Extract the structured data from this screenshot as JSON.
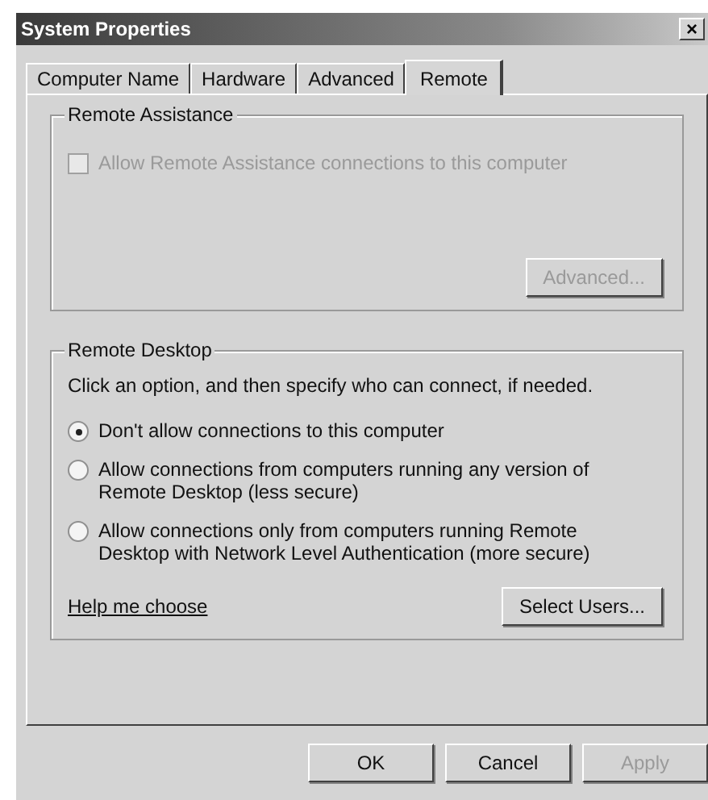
{
  "window": {
    "title": "System Properties",
    "close": "×"
  },
  "tabs": [
    {
      "label": "Computer Name",
      "selected": false
    },
    {
      "label": "Hardware",
      "selected": false
    },
    {
      "label": "Advanced",
      "selected": false
    },
    {
      "label": "Remote",
      "selected": true
    }
  ],
  "remote_assistance": {
    "title": "Remote Assistance",
    "checkbox": {
      "label": "Allow Remote Assistance connections to this computer",
      "checked": false,
      "disabled": true
    },
    "button": {
      "label": "Advanced...",
      "disabled": true
    }
  },
  "remote_desktop": {
    "title": "Remote Desktop",
    "instruction": "Click an option, and then specify who can connect, if needed.",
    "options": [
      {
        "label": "Don't allow connections to this computer",
        "selected": true
      },
      {
        "label": "Allow connections from computers running any version of Remote Desktop (less secure)",
        "selected": false
      },
      {
        "label": "Allow connections only from computers running Remote Desktop with Network Level Authentication (more secure)",
        "selected": false
      }
    ],
    "help_link": "Help me choose",
    "button": {
      "label": "Select Users...",
      "disabled": false
    }
  },
  "buttons": [
    {
      "label": "OK",
      "disabled": false
    },
    {
      "label": "Cancel",
      "disabled": false
    },
    {
      "label": "Apply",
      "disabled": true
    }
  ]
}
